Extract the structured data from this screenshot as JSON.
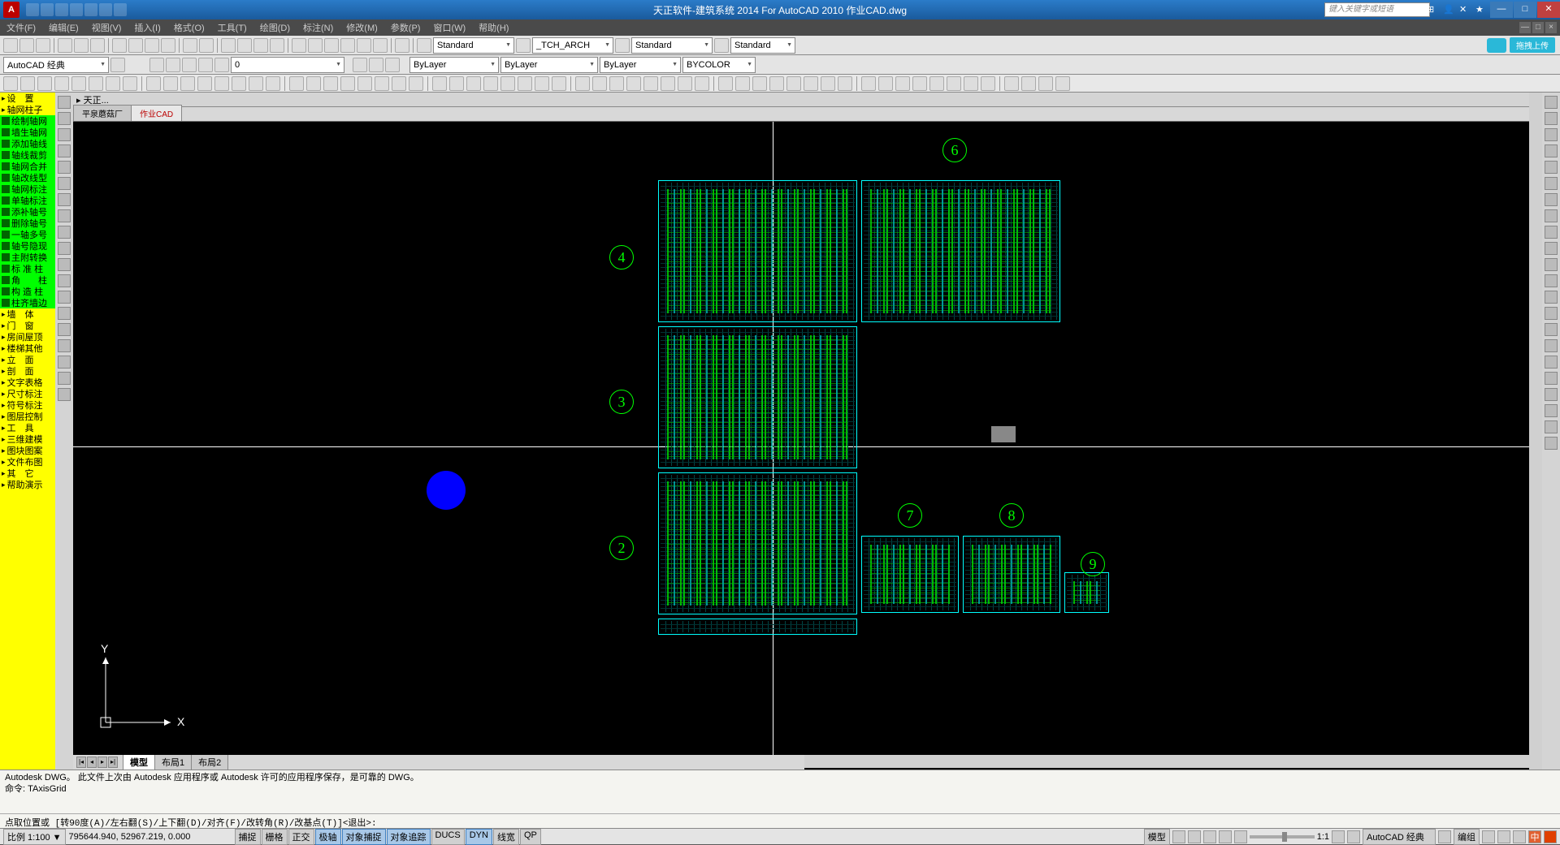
{
  "title": "天正软件-建筑系统 2014 For AutoCAD 2010     作业CAD.dwg",
  "search_ph": "键入关键字或短语",
  "cloud_label": "拖拽上传",
  "menu": [
    "文件(F)",
    "编辑(E)",
    "视图(V)",
    "插入(I)",
    "格式(O)",
    "工具(T)",
    "绘图(D)",
    "标注(N)",
    "修改(M)",
    "参数(P)",
    "窗口(W)",
    "帮助(H)"
  ],
  "workspace": "AutoCAD 经典",
  "layer0": "0",
  "style_std": "Standard",
  "tch_arch": "_TCH_ARCH",
  "style_std2": "Standard",
  "style_std3": "Standard",
  "bylayer": "ByLayer",
  "bylayer2": "ByLayer",
  "bylayer3": "ByLayer",
  "bycolor": "BYCOLOR",
  "tz_head": "▸ 天正...",
  "tz_items": [
    {
      "t": "hd",
      "l": "设　置"
    },
    {
      "t": "hd",
      "l": "轴网柱子"
    },
    {
      "t": "g",
      "l": "绘制轴网"
    },
    {
      "t": "g",
      "l": "墙生轴网"
    },
    {
      "t": "g",
      "l": "添加轴线"
    },
    {
      "t": "g",
      "l": "轴线裁剪"
    },
    {
      "t": "g",
      "l": "轴网合并"
    },
    {
      "t": "g",
      "l": "轴改线型"
    },
    {
      "t": "g",
      "l": "轴网标注"
    },
    {
      "t": "g",
      "l": "单轴标注"
    },
    {
      "t": "g",
      "l": "添补轴号"
    },
    {
      "t": "g",
      "l": "删除轴号"
    },
    {
      "t": "g",
      "l": "一轴多号"
    },
    {
      "t": "g",
      "l": "轴号隐现"
    },
    {
      "t": "g",
      "l": "主附转换"
    },
    {
      "t": "g",
      "l": "标 准 柱"
    },
    {
      "t": "g",
      "l": "角　　柱"
    },
    {
      "t": "g",
      "l": "构 造 柱"
    },
    {
      "t": "g",
      "l": "柱齐墙边"
    },
    {
      "t": "hd",
      "l": "墙　体"
    },
    {
      "t": "hd",
      "l": "门　窗"
    },
    {
      "t": "hd",
      "l": "房间屋顶"
    },
    {
      "t": "hd",
      "l": "楼梯其他"
    },
    {
      "t": "hd",
      "l": "立　面"
    },
    {
      "t": "hd",
      "l": "剖　面"
    },
    {
      "t": "hd",
      "l": "文字表格"
    },
    {
      "t": "hd",
      "l": "尺寸标注"
    },
    {
      "t": "hd",
      "l": "符号标注"
    },
    {
      "t": "hd",
      "l": "图层控制"
    },
    {
      "t": "hd",
      "l": "工　具"
    },
    {
      "t": "hd",
      "l": "三维建模"
    },
    {
      "t": "hd",
      "l": "图块图案"
    },
    {
      "t": "hd",
      "l": "文件布图"
    },
    {
      "t": "hd",
      "l": "其　它"
    },
    {
      "t": "hd",
      "l": "帮助演示"
    }
  ],
  "doc_tabs": [
    "平泉蘑菇厂",
    "作业CAD"
  ],
  "bottom_tabs": [
    "模型",
    "布局1",
    "布局2"
  ],
  "cmd_lines": [
    "Autodesk DWG。  此文件上次由 Autodesk 应用程序或 Autodesk 许可的应用程序保存，是可靠的 DWG。",
    "命令: TAxisGrid",
    ""
  ],
  "cmd_prompt": "点取位置或 [转90度(A)/左右翻(S)/上下翻(D)/对齐(F)/改转角(R)/改基点(T)]<退出>:",
  "scale_label": "比例 1:100 ▼",
  "coords": "795644.940, 52967.219, 0.000",
  "status_btns": [
    "捕捉",
    "栅格",
    "正交",
    "极轴",
    "对象捕捉",
    "对象追踪",
    "DUCS",
    "DYN",
    "线宽",
    "QP"
  ],
  "status_on": [
    false,
    false,
    false,
    true,
    true,
    true,
    false,
    true,
    false,
    false
  ],
  "status_right": [
    "模型",
    "1:1",
    "AutoCAD 经典",
    "编组"
  ],
  "ucs": {
    "x": "X",
    "y": "Y"
  },
  "circles": [
    "2",
    "3",
    "4",
    "6",
    "7",
    "8",
    "9"
  ]
}
